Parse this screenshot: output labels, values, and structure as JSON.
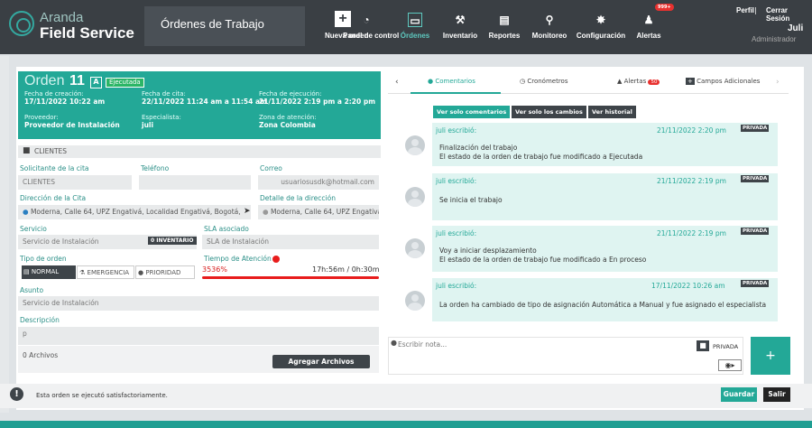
{
  "header": {
    "brand_top": "Aranda",
    "brand_bottom": "Field Service",
    "page_title": "Órdenes de Trabajo",
    "nav": [
      {
        "label": "Nueva orden",
        "icon": "plus-icon"
      },
      {
        "label": "Panel de control",
        "icon": "dashboard-icon"
      },
      {
        "label": "Órdenes",
        "icon": "orders-icon"
      },
      {
        "label": "Inventario",
        "icon": "inventory-icon"
      },
      {
        "label": "Reportes",
        "icon": "reports-icon"
      },
      {
        "label": "Monitoreo",
        "icon": "monitor-icon"
      },
      {
        "label": "Configuración",
        "icon": "gear-icon"
      },
      {
        "label": "Alertas",
        "icon": "bell-icon"
      }
    ],
    "alert_badge": "999+",
    "perfil": "Perfil",
    "cerrar_sesion": "Cerrar Sesión",
    "user_name": "Juli",
    "user_role": "Administrador"
  },
  "order": {
    "label": "Orden",
    "number": "11",
    "type_letter": "A",
    "status": "Ejecutada",
    "fecha_creacion_label": "Fecha de creación:",
    "fecha_creacion": "17/11/2022 10:22 am",
    "fecha_cita_label": "Fecha de cita:",
    "fecha_cita": "22/11/2022 11:24 am a 11:54 am",
    "fecha_ejecucion_label": "Fecha de ejecución:",
    "fecha_ejecucion": "21/11/2022 2:19 pm a 2:20 pm",
    "proveedor_label": "Proveedor:",
    "proveedor": "Proveedor de Instalación",
    "especialista_label": "Especialista:",
    "especialista": "juli",
    "zona_label": "Zona de atención:",
    "zona": "Zona Colombia"
  },
  "clients": {
    "section_title": "CLIENTES",
    "solicitante_label": "Solicitante de la cita",
    "solicitante": "CLIENTES",
    "telefono_label": "Teléfono",
    "telefono": "",
    "correo_label": "Correo",
    "correo": "usuariosusdk@hotmail.com",
    "direccion_label": "Dirección de la Cita",
    "direccion": "Moderna, Calle 64, UPZ Engativá, Localidad Engativá, Bogotá,",
    "detalle_label": "Detalle de la dirección",
    "detalle": "Moderna, Calle 64, UPZ Engativá, l"
  },
  "service": {
    "servicio_label": "Servicio",
    "servicio": "Servicio de Instalación",
    "inventario_badge": "0 INVENTARIO",
    "sla_label": "SLA asociado",
    "sla": "SLA de Instalación",
    "tipo_label": "Tipo de orden",
    "tipo_normal": "NORMAL",
    "tipo_emergencia": "EMERGENCIA",
    "tipo_prioridad": "PRIORIDAD",
    "tiempo_label": "Tiempo de Atención",
    "tiempo_pct": "3536%",
    "tiempo_val": "17h:56m / 0h:30m",
    "asunto_label": "Asunto",
    "asunto": "Servicio de Instalación",
    "descripcion_label": "Descripción",
    "descripcion": "p",
    "archivos": "0 Archivos",
    "agregar_archivos": "Agregar Archivos"
  },
  "tabs": {
    "comentarios": "Comentarios",
    "cronometros": "Cronómetros",
    "alertas": "Alertas",
    "alertas_badge": "50",
    "campos": "Campos Adicionales"
  },
  "filters": {
    "solo_comentarios": "Ver solo comentarios",
    "solo_cambios": "Ver solo los cambios",
    "historial": "Ver historial"
  },
  "comments": [
    {
      "author": "juli escribió:",
      "date": "21/11/2022 2:20 pm",
      "private": "PRIVADA",
      "line1": "Finalización del trabajo",
      "line2": "El estado de la orden de trabajo fue modificado a Ejecutada"
    },
    {
      "author": "juli escribió:",
      "date": "21/11/2022 2:19 pm",
      "private": "PRIVADA",
      "line1": "Se inicia el trabajo",
      "line2": ""
    },
    {
      "author": "juli escribió:",
      "date": "21/11/2022 2:19 pm",
      "private": "PRIVADA",
      "line1": "Voy a iniciar desplazamiento",
      "line2": "El estado de la orden de trabajo fue modificado a En proceso"
    },
    {
      "author": "juli escribió:",
      "date": "17/11/2022 10:26 am",
      "private": "PRIVADA",
      "line1": "La orden ha cambiado de tipo de asignación Automática a Manual y fue asignado el especialista",
      "line2": ""
    }
  ],
  "note": {
    "placeholder": "Escribir nota...",
    "privada": "PRIVADA"
  },
  "footer": {
    "message": "Esta orden se ejecutó satisfactoriamente.",
    "guardar": "Guardar",
    "salir": "Salir"
  },
  "colors": {
    "accent": "#23a897",
    "header": "#3a3f44",
    "danger": "#e81c1c"
  }
}
